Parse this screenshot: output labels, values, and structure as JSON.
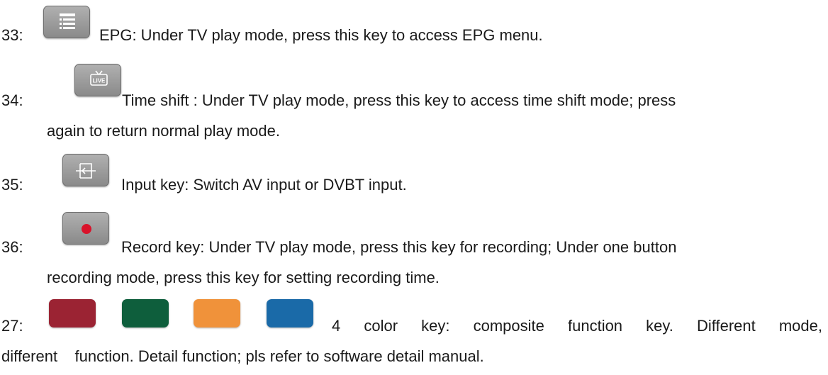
{
  "items": [
    {
      "number": "33:",
      "icon": "epg-list-icon",
      "text": "EPG: Under TV play mode, press this key to access EPG menu."
    },
    {
      "number": "34:",
      "icon": "live-tv-icon",
      "text": "Time shift : Under TV play mode, press this key to access time shift mode; press",
      "continuation": "again to return normal play mode."
    },
    {
      "number": "35:",
      "icon": "input-switch-icon",
      "text": "Input key: Switch AV input or DVBT input."
    },
    {
      "number": "36:",
      "icon": "record-dot-icon",
      "text": "Record key: Under TV play mode, press this key for recording; Under one button",
      "continuation": "recording mode, press this key for setting recording time."
    },
    {
      "number": "27:",
      "color_keys": [
        "#9b2333",
        "#0e5e3c",
        "#f0923a",
        "#1a6aa8"
      ],
      "text": "4 color key: composite function key. Different mode,",
      "continuation": "different    function. Detail function; pls refer to software detail manual."
    }
  ]
}
